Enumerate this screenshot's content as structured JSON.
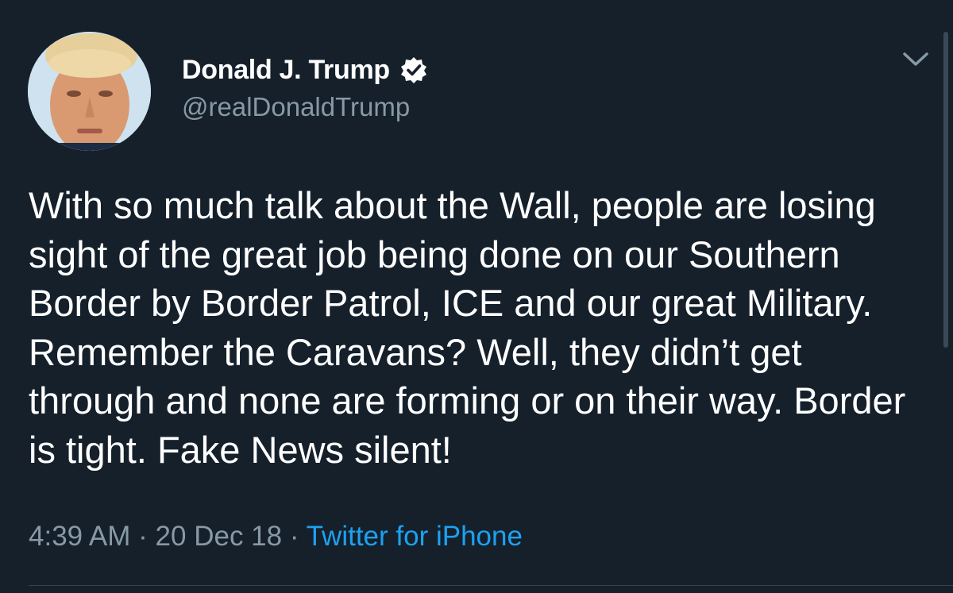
{
  "author": {
    "display_name": "Donald J. Trump",
    "handle": "@realDonaldTrump",
    "verified": true
  },
  "tweet": {
    "text": "With so much talk about the Wall, people are losing sight of the great job being done on our Southern Border by Border Patrol, ICE and our great Military. Remember the Caravans? Well, they didn’t get through and none are forming or on their way. Border is tight. Fake News silent!",
    "time": "4:39 AM",
    "separator": "·",
    "date": "20 Dec 18",
    "source": "Twitter for iPhone"
  },
  "icons": {
    "verified": "verified-badge-icon",
    "menu": "chevron-down-icon"
  },
  "colors": {
    "background": "#15202b",
    "secondary_text": "#8899a6",
    "link": "#1da1f2"
  }
}
